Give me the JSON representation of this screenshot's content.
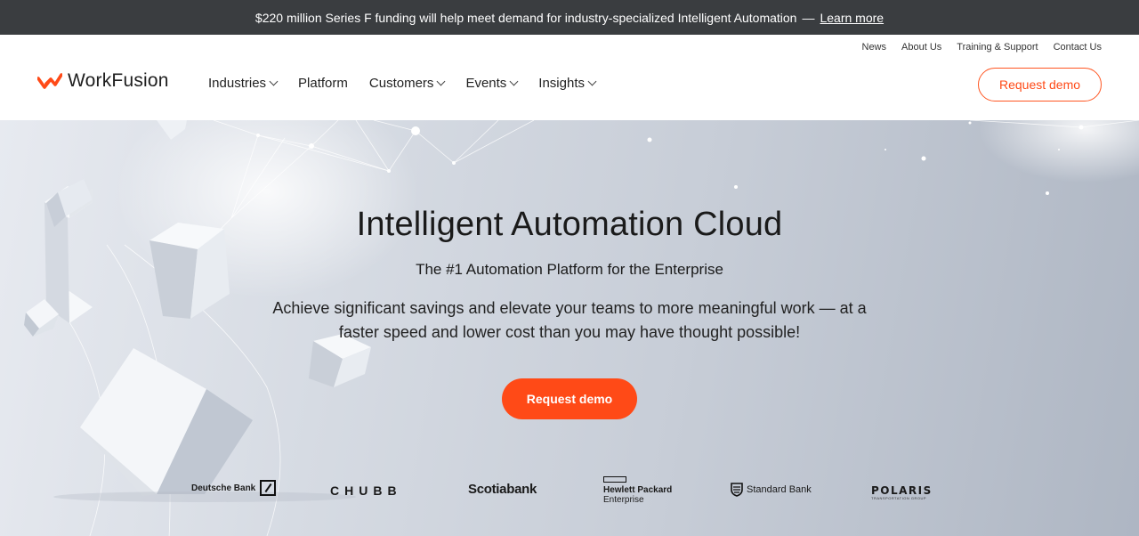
{
  "announcement": {
    "text": "$220 million Series F funding will help meet demand for industry-specialized Intelligent Automation",
    "separator": "—",
    "link_label": "Learn more"
  },
  "utility_nav": [
    "News",
    "About Us",
    "Training & Support",
    "Contact Us"
  ],
  "brand": {
    "name": "WorkFusion",
    "accent_color": "#ff4a17"
  },
  "main_nav": [
    {
      "label": "Industries",
      "has_dropdown": true
    },
    {
      "label": "Platform",
      "has_dropdown": false
    },
    {
      "label": "Customers",
      "has_dropdown": true
    },
    {
      "label": "Events",
      "has_dropdown": true
    },
    {
      "label": "Insights",
      "has_dropdown": true
    }
  ],
  "header_cta": {
    "label": "Request demo"
  },
  "hero": {
    "title": "Intelligent Automation Cloud",
    "subtitle": "The #1 Automation Platform for the Enterprise",
    "description": "Achieve significant savings and elevate your teams to more meaningful work — at a faster speed and lower cost than you may have thought possible!",
    "cta_label": "Request demo"
  },
  "customer_logos": {
    "deutsche_bank": "Deutsche Bank",
    "chubb": "CHUBB",
    "scotiabank": "Scotiabank",
    "hpe_line1": "Hewlett Packard",
    "hpe_line2": "Enterprise",
    "standard_bank": "Standard Bank",
    "polaris": "POLARIS",
    "polaris_tagline": "TRANSPORTATION GROUP"
  }
}
